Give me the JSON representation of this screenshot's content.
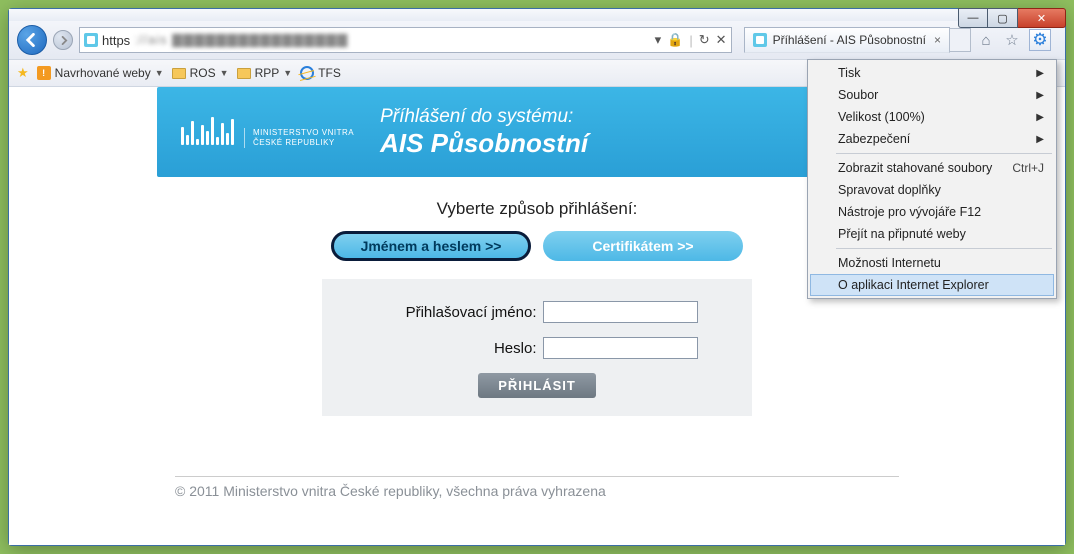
{
  "window_controls": {
    "min": "—",
    "max": "▢",
    "close": "✕"
  },
  "nav": {
    "url_scheme": "https",
    "url_rest": "://ais ▇▇▇▇▇▇▇▇▇▇▇▇▇▇▇▇",
    "lock_icon": "🔒",
    "refresh_icon": "↻",
    "stop_icon": "✕",
    "dropdown_icon": "▾"
  },
  "tab": {
    "title": "Příhlášení - AIS Působnostní"
  },
  "right_icons": {
    "home": "⌂",
    "star": "☆",
    "gear": "⚙"
  },
  "favbar": {
    "suggested": "Navrhované weby",
    "items": [
      {
        "label": "ROS"
      },
      {
        "label": "RPP"
      },
      {
        "label": "TFS"
      }
    ]
  },
  "banner": {
    "ministry_line1": "MINISTERSTVO VNITRA",
    "ministry_line2": "ČESKÉ REPUBLIKY",
    "title1": "Příhlášení do systému:",
    "title2": "AIS Působnostní"
  },
  "page": {
    "select_prompt": "Vyberte způsob přihlášení:",
    "btn_name_pass": "Jménem a heslem >>",
    "btn_cert": "Certifikátem >>",
    "label_user": "Přihlašovací jméno:",
    "label_pass": "Heslo:",
    "submit": "PŘIHLÁSIT",
    "footer": "© 2011 Ministerstvo vnitra České republiky, všechna práva vyhrazena"
  },
  "menu": {
    "items_top": [
      {
        "label": "Tisk",
        "sub": true
      },
      {
        "label": "Soubor",
        "sub": true
      },
      {
        "label": "Velikost (100%)",
        "sub": true
      },
      {
        "label": "Zabezpečení",
        "sub": true
      }
    ],
    "items_mid": [
      {
        "label": "Zobrazit stahované soubory",
        "shortcut": "Ctrl+J"
      },
      {
        "label": "Spravovat doplňky"
      },
      {
        "label": "Nástroje pro vývojáře F12"
      },
      {
        "label": "Přejít na připnuté weby"
      }
    ],
    "items_bot": [
      {
        "label": "Možnosti Internetu"
      },
      {
        "label": "O aplikaci Internet Explorer",
        "hover": true
      }
    ]
  }
}
